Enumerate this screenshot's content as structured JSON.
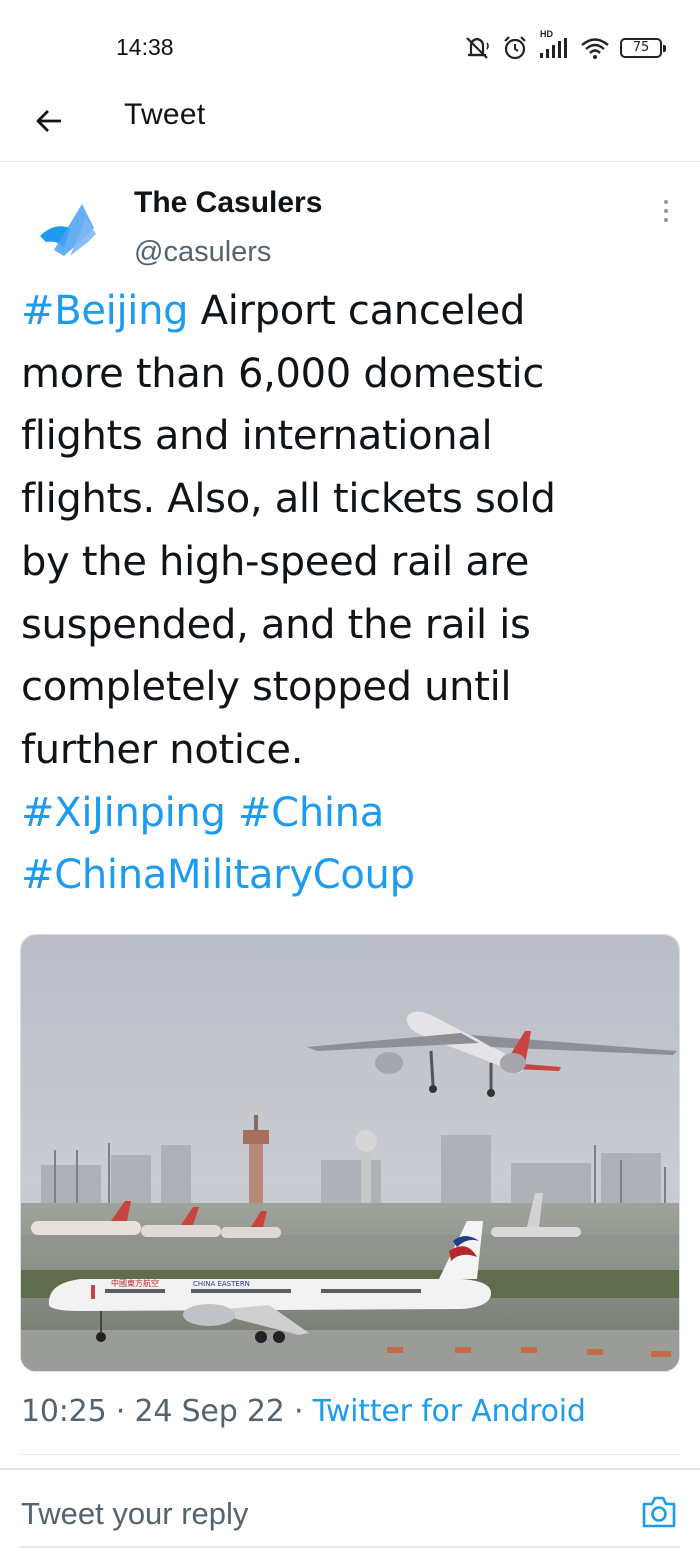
{
  "status_bar": {
    "time": "14:38",
    "icons": [
      "mute-icon",
      "alarm-icon",
      "signal-icon",
      "wifi-icon",
      "battery-icon"
    ],
    "hd_label": "HD",
    "battery_level": "75"
  },
  "header": {
    "back_icon": "arrow-left-icon",
    "title": "Tweet"
  },
  "tweet": {
    "author": {
      "display_name": "The Casulers",
      "handle": "@casulers"
    },
    "text_lines": [
      {
        "hashtag": "#Beijing",
        "text": " Airport canceled"
      },
      {
        "text": "more than 6,000 domestic"
      },
      {
        "text": "flights and international"
      },
      {
        "text": "flights. Also, all tickets sold"
      },
      {
        "text": "by the high-speed rail are"
      },
      {
        "text": "suspended, and the rail is"
      },
      {
        "text": "completely stopped until"
      },
      {
        "text": "further notice."
      },
      {
        "hashtags": [
          "#XiJinping",
          "#China"
        ]
      },
      {
        "hashtag": "#ChinaMilitaryCoup"
      }
    ],
    "media": {
      "type": "photo",
      "aircraft_livery_text_1": "中國東方航空",
      "aircraft_livery_text_2": "CHINA EASTERN"
    },
    "meta": {
      "time": "10:25",
      "separator": " · ",
      "date": "24 Sep 22",
      "source": "Twitter for Android"
    }
  },
  "reply": {
    "placeholder": "Tweet your reply",
    "camera_icon": "camera-icon"
  },
  "colors": {
    "accent": "#1d9bf0",
    "text": "#0f1419",
    "secondary": "#536471"
  }
}
